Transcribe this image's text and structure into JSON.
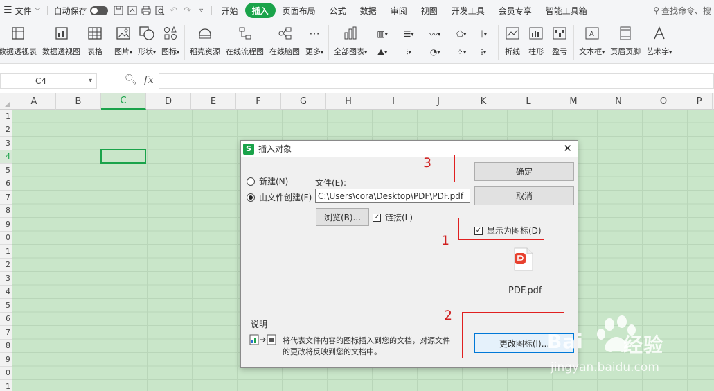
{
  "menu": {
    "file": "文件",
    "autosave": "自动保存",
    "tabs": [
      "开始",
      "插入",
      "页面布局",
      "公式",
      "数据",
      "审阅",
      "视图",
      "开发工具",
      "会员专享",
      "智能工具箱"
    ],
    "active_tab": "插入",
    "search": "查找命令、搜"
  },
  "ribbon": {
    "items": [
      "数据透视表",
      "数据透视图",
      "表格",
      "图片",
      "形状",
      "图标",
      "稻壳资源",
      "在线流程图",
      "在线脑图",
      "更多",
      "全部图表",
      "折线",
      "柱形",
      "盈亏",
      "文本框",
      "页眉页脚",
      "艺术字"
    ]
  },
  "formula_bar": {
    "cell_ref": "C4",
    "fx": "fx"
  },
  "sheet": {
    "columns": [
      "A",
      "B",
      "C",
      "D",
      "E",
      "F",
      "G",
      "H",
      "I",
      "J",
      "K",
      "L",
      "M",
      "N",
      "O",
      "P"
    ],
    "selected_column": "C",
    "rows": [
      "1",
      "2",
      "3",
      "4",
      "5",
      "6",
      "7",
      "8",
      "9",
      "0",
      "1",
      "2",
      "3",
      "4",
      "5",
      "6",
      "7",
      "8",
      "9",
      "0",
      "1"
    ],
    "selected_row_index": 3
  },
  "dialog": {
    "title": "插入对象",
    "radio_new": "新建(N)",
    "radio_from_file": "由文件创建(F)",
    "file_label": "文件(E):",
    "file_path": "C:\\Users\\cora\\Desktop\\PDF\\PDF.pdf",
    "browse": "浏览(B)...",
    "link": "链接(L)",
    "ok": "确定",
    "cancel": "取消",
    "display_as_icon": "显示为图标(D)",
    "icon_caption": "PDF.pdf",
    "desc_title": "说明",
    "desc_text_1": "将代表文件内容的图标插入到您的文档，对源文件",
    "desc_text_2": "的更改将反映到您的文档中。",
    "change_icon": "更改图标(I)..."
  },
  "annotations": [
    "1",
    "2",
    "3"
  ],
  "watermark": {
    "brand": "Bai",
    "brand2": "经验",
    "url": "jingyan.baidu.com"
  },
  "colors": {
    "accent": "#1aa34a",
    "sheet_bg": "#c9e6c9",
    "annotation": "#e02020"
  }
}
